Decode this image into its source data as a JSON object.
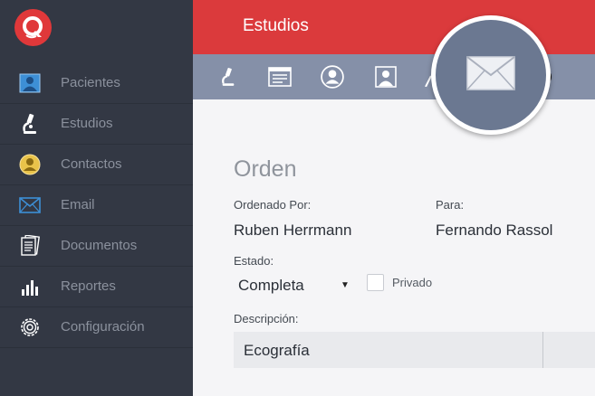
{
  "header": {
    "title": "Estudios"
  },
  "sidebar": {
    "items": [
      {
        "label": "Pacientes",
        "icon": "patient-icon"
      },
      {
        "label": "Estudios",
        "icon": "microscope-icon"
      },
      {
        "label": "Contactos",
        "icon": "contact-icon"
      },
      {
        "label": "Email",
        "icon": "envelope-icon"
      },
      {
        "label": "Documentos",
        "icon": "documents-icon"
      },
      {
        "label": "Reportes",
        "icon": "bar-chart-icon"
      },
      {
        "label": "Configuración",
        "icon": "gear-icon"
      }
    ]
  },
  "toolbar": {
    "icons": [
      "microscope-icon",
      "list-card-icon",
      "contact-circle-icon",
      "patient-card-icon",
      "user-icon",
      "envelope-icon"
    ]
  },
  "form": {
    "title": "Orden",
    "ordered_by_label": "Ordenado Por:",
    "ordered_by_value": "Ruben Herrmann",
    "for_label": "Para:",
    "for_value": "Fernando Rassol",
    "status_label": "Estado:",
    "status_value": "Completa",
    "private_label": "Privado",
    "private_checked": false,
    "description_label": "Descripción:",
    "description_value": "Ecografía"
  },
  "colors": {
    "header": "#db3a3c",
    "sidebar": "#333844",
    "toolbar": "#8590a8",
    "accent_blue": "#3d8fd6",
    "accent_yellow": "#e9c34a"
  }
}
